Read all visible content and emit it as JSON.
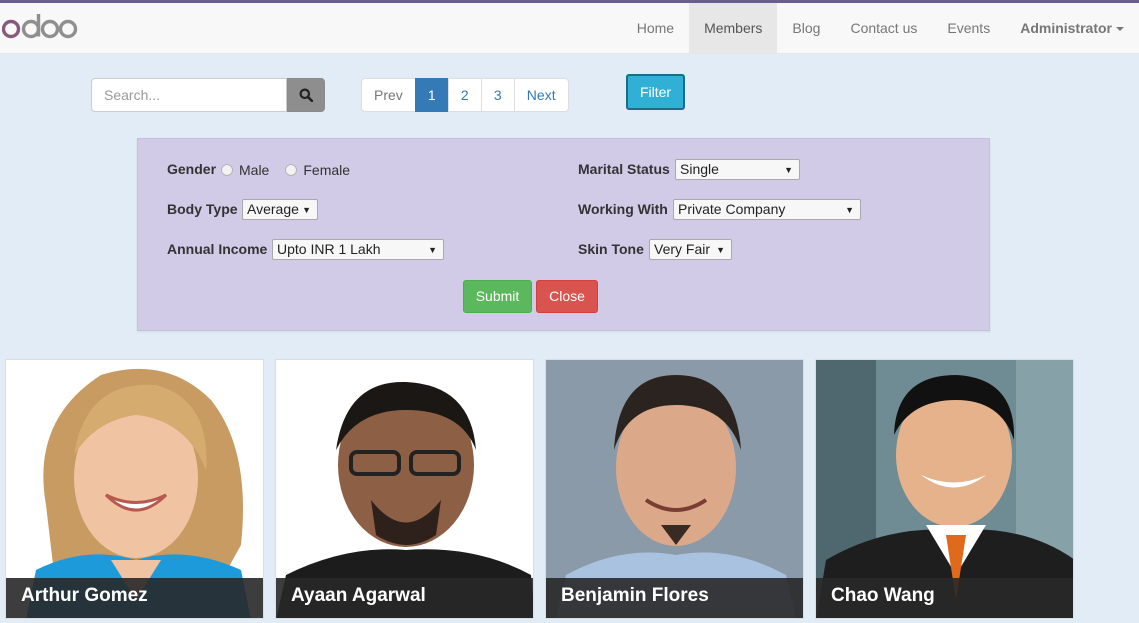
{
  "brand": {
    "logo_text": "odoo",
    "colors": {
      "o1": "#875a7b",
      "rest": "#8f8f8f"
    }
  },
  "nav": {
    "items": [
      {
        "label": "Home",
        "active": false
      },
      {
        "label": "Members",
        "active": true
      },
      {
        "label": "Blog",
        "active": false
      },
      {
        "label": "Contact us",
        "active": false
      },
      {
        "label": "Events",
        "active": false
      }
    ],
    "user_menu": "Administrator"
  },
  "search": {
    "placeholder": "Search...",
    "icon": "search-icon"
  },
  "pager": {
    "prev": "Prev",
    "pages": [
      "1",
      "2",
      "3"
    ],
    "current": "1",
    "next": "Next"
  },
  "filter_button": "Filter",
  "filters": {
    "gender": {
      "label": "Gender",
      "options": [
        "Male",
        "Female"
      ]
    },
    "marital_status": {
      "label": "Marital Status",
      "value": "Single"
    },
    "body_type": {
      "label": "Body Type",
      "value": "Average"
    },
    "working_with": {
      "label": "Working With",
      "value": "Private Company"
    },
    "annual_income": {
      "label": "Annual Income",
      "value": "Upto INR 1 Lakh"
    },
    "skin_tone": {
      "label": "Skin Tone",
      "value": "Very Fair"
    },
    "submit": "Submit",
    "close": "Close"
  },
  "members": [
    {
      "name": "Arthur Gomez"
    },
    {
      "name": "Ayaan Agarwal"
    },
    {
      "name": "Benjamin Flores"
    },
    {
      "name": "Chao Wang"
    }
  ]
}
